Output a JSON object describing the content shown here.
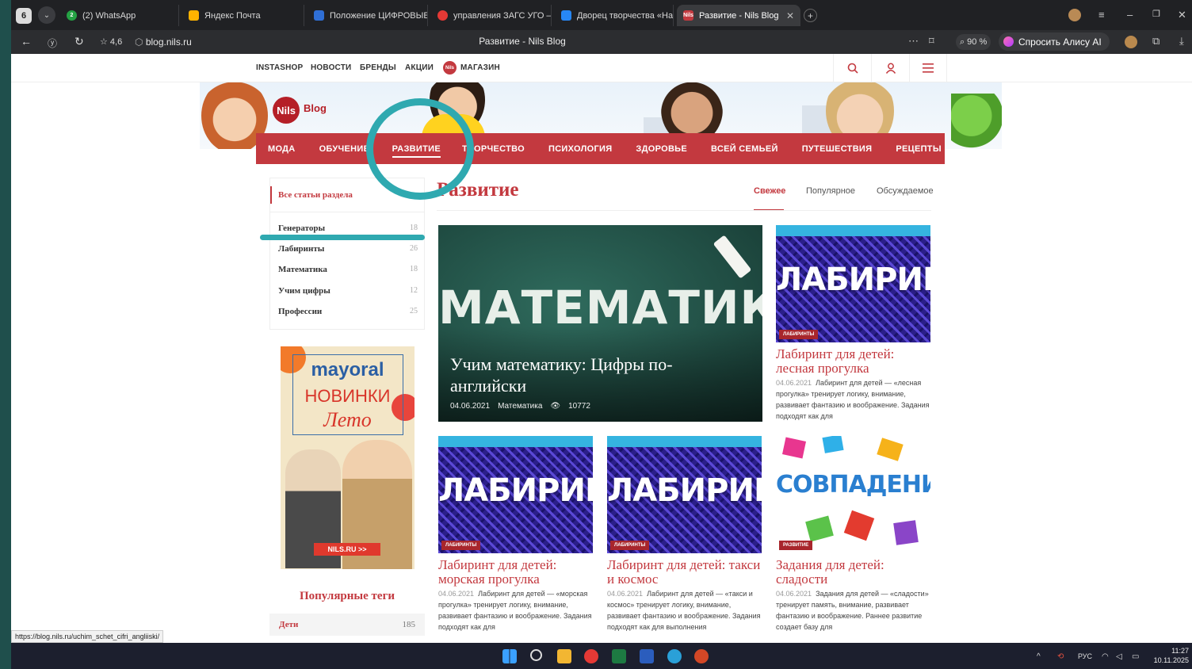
{
  "browser": {
    "tab_count": "6",
    "tabs": [
      {
        "title": "(2) WhatsApp",
        "badge": "2"
      },
      {
        "title": "Яндекс Почта"
      },
      {
        "title": "Положение ЦИФРОВЫЕ"
      },
      {
        "title": "управления ЗАГС УГО –"
      },
      {
        "title": "Дворец творчества «На /"
      },
      {
        "title": "Развитие - Nils Blog",
        "favicon": "Nils"
      }
    ],
    "rating": "☆ 4,6",
    "url": "blog.nils.ru",
    "page_title": "Развитие - Nils Blog",
    "zoom": "90 %",
    "alice_label": "Спросить Алису AI"
  },
  "site": {
    "top_nav": [
      "INSTASHOP",
      "НОВОСТИ",
      "БРЕНДЫ",
      "АКЦИИ",
      "МАГАЗИН"
    ],
    "shop_badge": "Nils",
    "logo_main": "Nils",
    "logo_sub": "Blog",
    "menu": [
      "МОДА",
      "ОБУЧЕНИЕ",
      "РАЗВИТИЕ",
      "ТВОРЧЕСТВО",
      "ПСИХОЛОГИЯ",
      "ЗДОРОВЬЕ",
      "ВСЕЙ СЕМЬЕЙ",
      "ПУТЕШЕСТВИЯ",
      "РЕЦЕПТЫ"
    ]
  },
  "sidebar": {
    "all_label": "Все статьи раздела",
    "categories": [
      {
        "name": "Генераторы",
        "count": "18"
      },
      {
        "name": "Лабиринты",
        "count": "26"
      },
      {
        "name": "Математика",
        "count": "18"
      },
      {
        "name": "Учим цифры",
        "count": "12"
      },
      {
        "name": "Профессии",
        "count": "25"
      }
    ],
    "ad": {
      "brand": "mayoral",
      "line1": "НОВИНКИ",
      "line2": "Лето",
      "cta": "NILS.RU >>"
    },
    "tags_title": "Популярные теги",
    "tags": [
      {
        "name": "Дети",
        "count": "185"
      }
    ]
  },
  "main": {
    "heading": "Развитие",
    "sort": [
      "Свежее",
      "Популярное",
      "Обсуждаемое"
    ],
    "featured": {
      "image_word": "МАТЕМАТИКА",
      "title": "Учим математику: Цифры по-английски",
      "date": "04.06.2021",
      "category": "Математика",
      "views": "10772"
    },
    "cards": [
      {
        "image_word": "ЛАБИРИНТЫ",
        "badge": "ЛАБИРИНТЫ",
        "title": "Лабиринт для детей: лесная прогулка",
        "date": "04.06.2021",
        "text": "Лабиринт для детей — «лесная прогулка» тренирует логику, внимание, развивает фантазию и воображение. Задания подходят как для"
      },
      {
        "image_word": "ЛАБИРИНТЫ",
        "badge": "ЛАБИРИНТЫ",
        "title": "Лабиринт для детей: морская прогулка",
        "date": "04.06.2021",
        "text": "Лабиринт для детей — «морская прогулка» тренирует логику, внимание, развивает фантазию и воображение. Задания подходят как для"
      },
      {
        "image_word": "ЛАБИРИНТЫ",
        "badge": "ЛАБИРИНТЫ",
        "title": "Лабиринт для детей: такси и космос",
        "date": "04.06.2021",
        "text": "Лабиринт для детей — «такси и космос» тренирует логику, внимание, развивает фантазию и воображение. Задания подходят как для выполнения"
      },
      {
        "image_word": "СОВПАДЕНИЕ",
        "badge": "РАЗВИТИЕ",
        "title": "Задания для детей: сладости",
        "date": "04.06.2021",
        "text": "Задания для детей — «сладости» тренирует память, внимание, развивает фантазию и воображение. Раннее развитие создает базу для"
      }
    ]
  },
  "status_url": "https://blog.nils.ru/uchim_schet_cifri_angliiski/",
  "taskbar": {
    "lang": "РУС",
    "time": "11:27",
    "date": "10.11.2025"
  }
}
